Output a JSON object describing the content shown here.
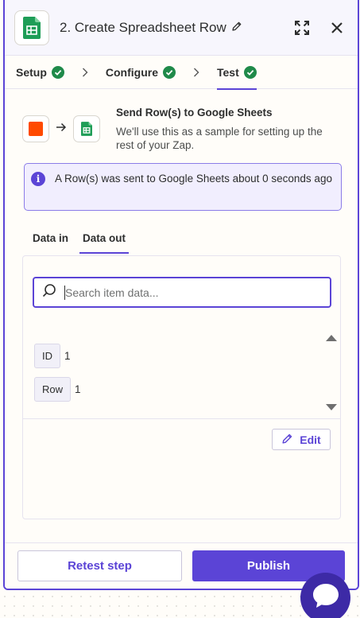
{
  "header": {
    "title": "2. Create Spreadsheet Row",
    "app_icon": "google-sheets-icon"
  },
  "steps": [
    {
      "label": "Setup",
      "status": "complete"
    },
    {
      "label": "Configure",
      "status": "complete"
    },
    {
      "label": "Test",
      "status": "complete",
      "active": true
    }
  ],
  "summary": {
    "title": "Send Row(s) to Google Sheets",
    "description": "We'll use this as a sample for setting up the rest of your Zap."
  },
  "alert": {
    "text": "A Row(s) was sent to Google Sheets about 0 seconds ago"
  },
  "tabs": [
    {
      "label": "Data in"
    },
    {
      "label": "Data out",
      "active": true
    }
  ],
  "search": {
    "placeholder": "Search item data..."
  },
  "items": [
    {
      "key": "ID",
      "value": "1"
    },
    {
      "key": "Row",
      "value": "1"
    }
  ],
  "edit_label": "Edit",
  "footer": {
    "retest_label": "Retest step",
    "publish_label": "Publish"
  },
  "colors": {
    "accent": "#5b44d6",
    "success": "#1f8a4a",
    "zapier_orange": "#ff4a00",
    "sheets_green": "#1e9d57"
  }
}
